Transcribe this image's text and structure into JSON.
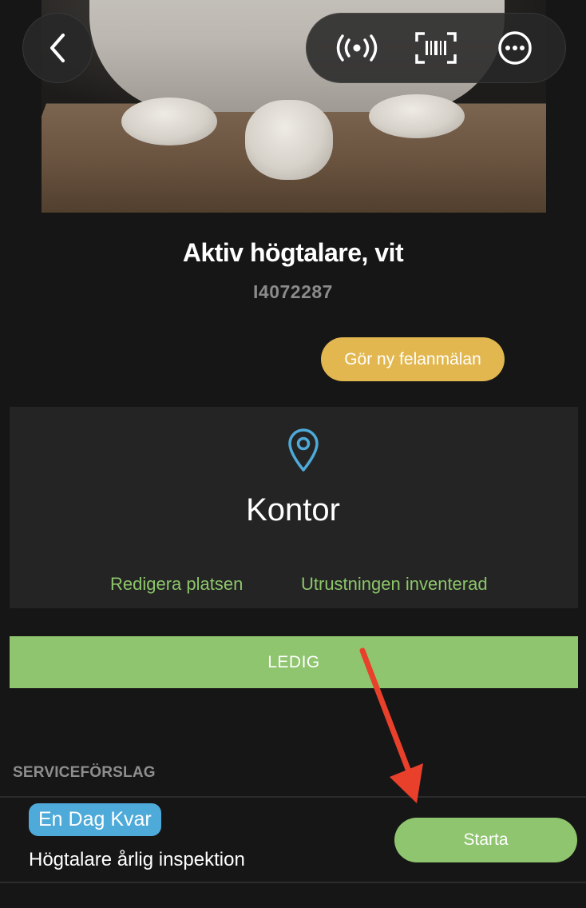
{
  "header": {
    "back_icon": "chevron-left-icon",
    "actions": [
      {
        "icon": "nfc-signal-icon"
      },
      {
        "icon": "barcode-scan-icon"
      },
      {
        "icon": "more-options-icon"
      }
    ]
  },
  "product": {
    "name": "Aktiv högtalare, vit",
    "id": "I4072287"
  },
  "report_button_label": "Gör ny felanmälan",
  "location": {
    "icon": "location-pin-icon",
    "name": "Kontor",
    "edit_label": "Redigera platsen",
    "inventory_label": "Utrustningen inventerad"
  },
  "status": {
    "label": "LEDIG"
  },
  "service": {
    "section_title": "SERVICEFÖRSLAG",
    "items": [
      {
        "badge": "En Dag Kvar",
        "name": "Högtalare årlig inspektion",
        "start_label": "Starta"
      }
    ]
  },
  "colors": {
    "background": "#161616",
    "card": "#242424",
    "accent_green": "#8fc56e",
    "link_green": "#8cc56a",
    "report_yellow": "#e2b74f",
    "badge_blue": "#4eaad9",
    "pin_blue": "#4eaad9",
    "annotation_red": "#e8402b"
  }
}
